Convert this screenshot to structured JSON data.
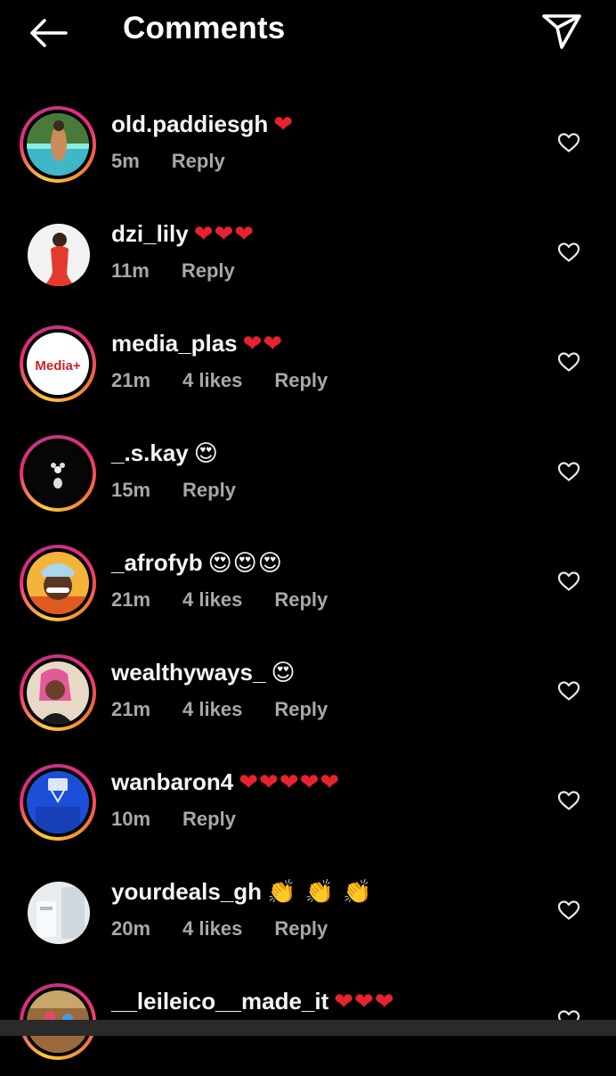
{
  "header": {
    "title": "Comments",
    "back_icon": "arrow-left-icon",
    "send_icon": "paper-plane-icon"
  },
  "colors": {
    "background": "#000000",
    "text": "#ffffff",
    "meta": "#a8a8a8",
    "heart_emoji": "#e8222f",
    "story_ring": [
      "#f9ce34",
      "#ee2a7b",
      "#c13584"
    ]
  },
  "comments": [
    {
      "username": "old.paddiesgh",
      "emoji": "❤",
      "time": "5m",
      "likes": "",
      "reply": "Reply"
    },
    {
      "username": "dzi_lily",
      "emoji": "❤❤❤",
      "time": "11m",
      "likes": "",
      "reply": "Reply"
    },
    {
      "username": "media_plas",
      "emoji": "❤❤",
      "time": "21m",
      "likes": "4 likes",
      "reply": "Reply"
    },
    {
      "username": "_.s.kay",
      "emoji": "😍",
      "time": "15m",
      "likes": "",
      "reply": "Reply"
    },
    {
      "username": "_afrofyb",
      "emoji": "😍😍😍",
      "time": "21m",
      "likes": "4 likes",
      "reply": "Reply"
    },
    {
      "username": "wealthyways_",
      "emoji": "😍",
      "time": "21m",
      "likes": "4 likes",
      "reply": "Reply"
    },
    {
      "username": "wanbaron4",
      "emoji": "❤❤❤❤❤",
      "time": "10m",
      "likes": "",
      "reply": "Reply"
    },
    {
      "username": "yourdeals_gh",
      "emoji": "👏 👏 👏",
      "time": "20m",
      "likes": "4 likes",
      "reply": "Reply"
    },
    {
      "username": "__leileico__made_it",
      "emoji": "❤❤❤",
      "time": "",
      "likes": "",
      "reply": ""
    }
  ],
  "avatar_logo_text": "Media+"
}
